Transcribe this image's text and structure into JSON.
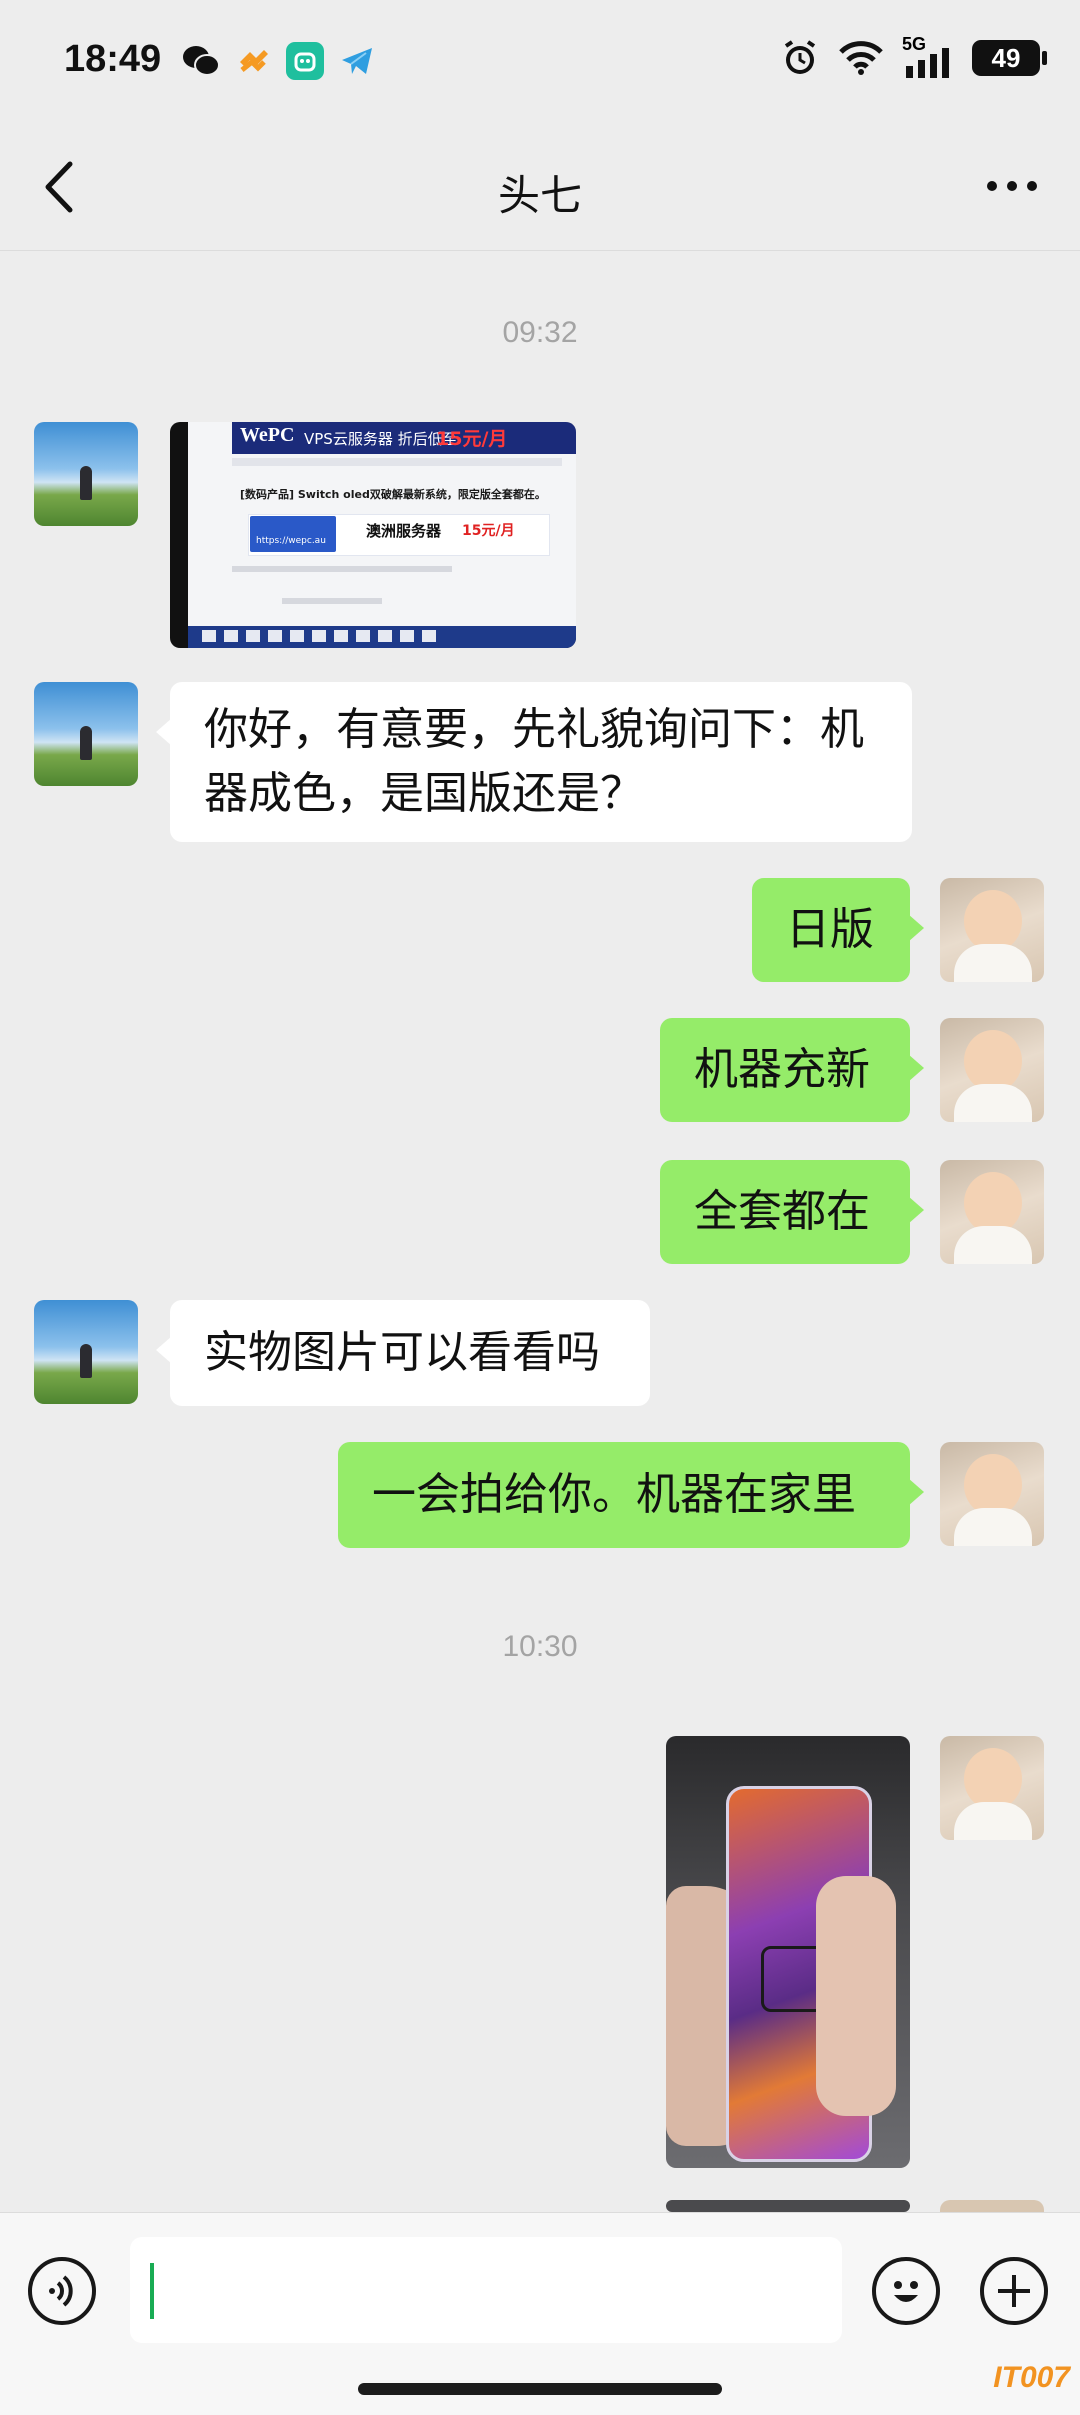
{
  "status_bar": {
    "time": "18:49",
    "network": "5G",
    "battery": "49",
    "left_icons": [
      "wechat-icon",
      "app-heart-icon",
      "mi-home-icon",
      "telegram-icon"
    ],
    "right_icons": [
      "alarm-icon",
      "wifi-icon",
      "signal-icon",
      "battery-icon"
    ]
  },
  "nav": {
    "title": "头七",
    "back_icon": "chevron-left-icon",
    "more_icon": "more-dots-icon"
  },
  "timestamps": [
    "09:32",
    "10:30"
  ],
  "messages": [
    {
      "from": "other",
      "type": "image",
      "caption": {
        "brand": "WePC",
        "title": "VPS云服务器 折后低至",
        "price": "15元/月",
        "sub": "[数码产品] Switch oled双破解最新系统，限定版全套都在。",
        "ad": "澳洲服务器",
        "ad_price": "15元/月",
        "url": "https://wepc.au"
      }
    },
    {
      "from": "other",
      "type": "text",
      "line1": "你好，有意要，先礼貌询问下：机",
      "line2": "器成色，是国版还是？"
    },
    {
      "from": "me",
      "type": "text",
      "text": "日版"
    },
    {
      "from": "me",
      "type": "text",
      "text": "机器充新"
    },
    {
      "from": "me",
      "type": "text",
      "text": "全套都在"
    },
    {
      "from": "other",
      "type": "text",
      "text": "实物图片可以看看吗"
    },
    {
      "from": "me",
      "type": "text",
      "text": "一会拍给你。机器在家里"
    },
    {
      "from": "me",
      "type": "image"
    }
  ],
  "input": {
    "value": "",
    "voice_icon": "voice-icon",
    "emoji_icon": "emoji-icon",
    "plus_icon": "plus-icon"
  },
  "watermark": "IT007",
  "colors": {
    "background": "#ededed",
    "my_bubble": "#95ec69",
    "other_bubble": "#ffffff",
    "timestamp": "#a4a4a4"
  }
}
